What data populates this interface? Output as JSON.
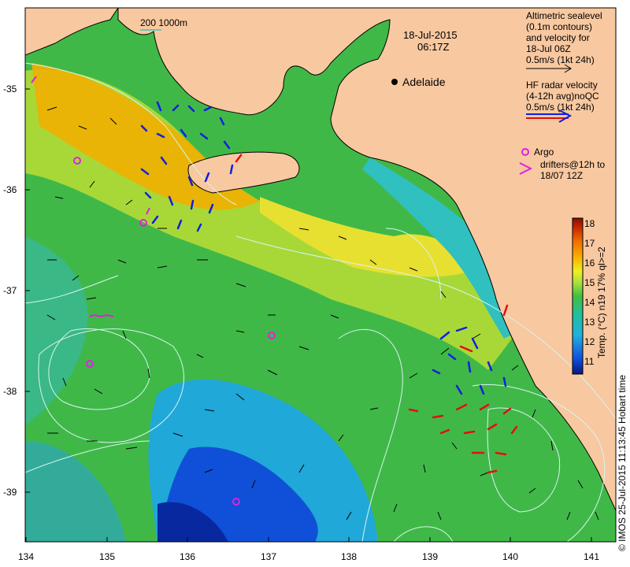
{
  "map": {
    "date_line": "18-Jul-2015",
    "time_line": "06:17Z",
    "scale_bar_label": "200  1000m",
    "city": {
      "name": "Adelaide",
      "lon": 138.6,
      "lat": -34.93
    },
    "x_ticks": [
      "134",
      "135",
      "136",
      "137",
      "138",
      "139",
      "140",
      "141"
    ],
    "y_ticks": [
      "-35",
      "-36",
      "-37",
      "-38",
      "-39"
    ],
    "lon_range": [
      134,
      141.3
    ],
    "lat_range": [
      -39.5,
      -34.6
    ]
  },
  "legend": {
    "alt_lines": [
      "Altimetric sealevel",
      "(0.1m contours)",
      "and velocity for",
      "18-Jul 06Z",
      "0.5m/s (1kt 24h)"
    ],
    "hf_lines": [
      "HF radar velocity",
      "(4-12h avg)noQC",
      "0.5m/s (1kt 24h)"
    ],
    "argo_lines": [
      "Argo",
      "drifters@12h to",
      "18/07 12Z"
    ]
  },
  "colorbar": {
    "label": "Temp. (°C) n19 17% ql>=2",
    "ticks": [
      "18",
      "17",
      "16",
      "15",
      "14",
      "13",
      "12",
      "11"
    ],
    "range": [
      10.5,
      18.3
    ]
  },
  "credit": "© IMOS 25-Jul-2015 11:13:45 Hobart time",
  "colors": {
    "land": "#f8c8a0",
    "coast": "#000000",
    "contour": "#d8f4f0",
    "argo": "#e020e0",
    "hf_blue": "#1020e0",
    "hf_red": "#e01010",
    "scale": "#40c0c0"
  }
}
